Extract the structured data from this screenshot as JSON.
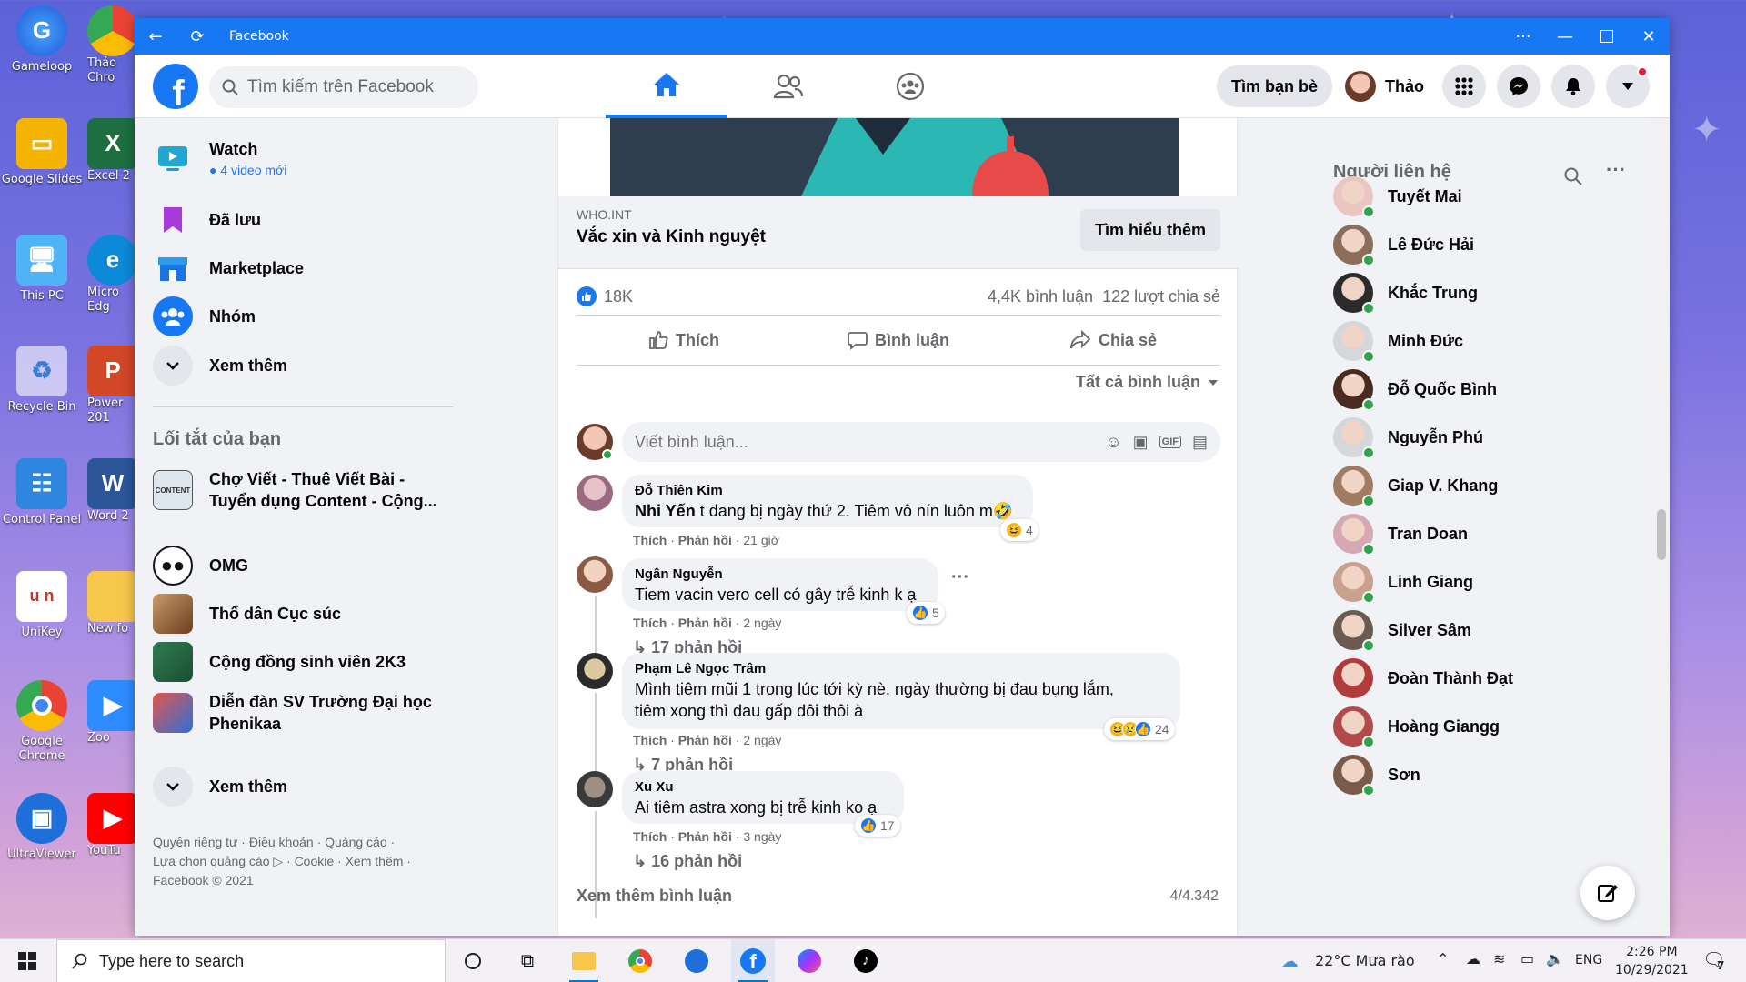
{
  "desktop": {
    "icons": [
      "Gameloop",
      "Google Slides",
      "This PC",
      "Recycle Bin",
      "Control Panel",
      "UniKey",
      "Google Chrome",
      "UltraViewer"
    ],
    "partial_icons": [
      "Thảo Chro",
      "Excel 2",
      "Micro Edg",
      "Power 201",
      "Word 2",
      "New fo",
      "Zoo",
      "YouTu"
    ]
  },
  "window": {
    "title": "Facebook",
    "menu": "···"
  },
  "topnav": {
    "logo": "f",
    "search_placeholder": "Tìm kiếm trên Facebook",
    "find_friends": "Tìm bạn bè",
    "profile_name": "Thảo"
  },
  "left": {
    "items": [
      {
        "label": "Watch",
        "sub": "4 video mới"
      },
      {
        "label": "Đã lưu"
      },
      {
        "label": "Marketplace"
      },
      {
        "label": "Nhóm"
      },
      {
        "label": "Xem thêm"
      }
    ],
    "shortcuts_title": "Lối tắt của bạn",
    "shortcuts": [
      "Chợ Viết - Thuê Viết Bài - Tuyển dụng Content - Cộng...",
      "OMG",
      "Thổ dân Cục súc",
      "Cộng đồng sinh viên 2K3",
      "Diễn đàn SV Trường Đại học Phenikaa"
    ],
    "shortcuts_more": "Xem thêm",
    "footer_line1": "Quyền riêng tư · Điều khoản · Quảng cáo ·",
    "footer_line2": "Lựa chọn quảng cáo ▷ · Cookie · Xem thêm ·",
    "footer_line3": "Facebook © 2021"
  },
  "post": {
    "link_domain": "WHO.INT",
    "link_title": "Vắc xin và Kinh nguyệt",
    "learn_more": "Tìm hiểu thêm",
    "likes": "18K",
    "comments_count": "4,4K bình luận",
    "shares": "122 lượt chia sẻ",
    "like_label": "Thích",
    "comment_label": "Bình luận",
    "share_label": "Chia sẻ",
    "all_comments": "Tất cả bình luận",
    "comment_placeholder": "Viết bình luận...",
    "comments": [
      {
        "name": "Đỗ Thiên Kim",
        "mention": "Nhi Yến",
        "text": " t đang bị ngày thứ 2. Tiêm vô nín luôn m🤣",
        "like": "Thích",
        "reply": "Phản hồi",
        "time": "21 giờ",
        "reactions": "4"
      },
      {
        "name": "Ngân Nguyễn",
        "text": "Tiem vacin vero cell có gây trễ kinh k ạ",
        "like": "Thích",
        "reply": "Phản hồi",
        "time": "2 ngày",
        "reactions": "5",
        "replies": "17 phản hồi"
      },
      {
        "name": "Phạm Lê Ngọc Trâm",
        "text1": "Mình tiêm mũi 1 trong lúc tới kỳ nè, ngày thường bị đau bụng lắm,",
        "text2": "tiêm xong thì đau gấp đôi thôi à",
        "like": "Thích",
        "reply": "Phản hồi",
        "time": "2 ngày",
        "reactions": "24",
        "replies": "7 phản hồi"
      },
      {
        "name": "Xu Xu",
        "text": "Ai tiêm astra xong bị trễ kinh ko ạ",
        "like": "Thích",
        "reply": "Phản hồi",
        "time": "3 ngày",
        "reactions": "17",
        "replies": "16 phản hồi"
      }
    ],
    "more_comments": "Xem thêm bình luận",
    "comment_progress": "4/4.342"
  },
  "contacts": {
    "title": "Người liên hệ",
    "list": [
      "Tuyết Mai",
      "Lê Đức Hải",
      "Khắc Trung",
      "Minh Đức",
      "Đỗ Quốc Bình",
      "Nguyễn Phú",
      "Giap V. Khang",
      "Tran Doan",
      "Linh Giang",
      "Silver Sâm",
      "Đoàn Thành Đạt",
      "Hoàng Giangg",
      "Sơn"
    ]
  },
  "taskbar": {
    "search_placeholder": "Type here to search",
    "weather": "22°C  Mưa rào",
    "lang": "ENG",
    "time": "2:26 PM",
    "date": "10/29/2021",
    "notifications": "7"
  }
}
